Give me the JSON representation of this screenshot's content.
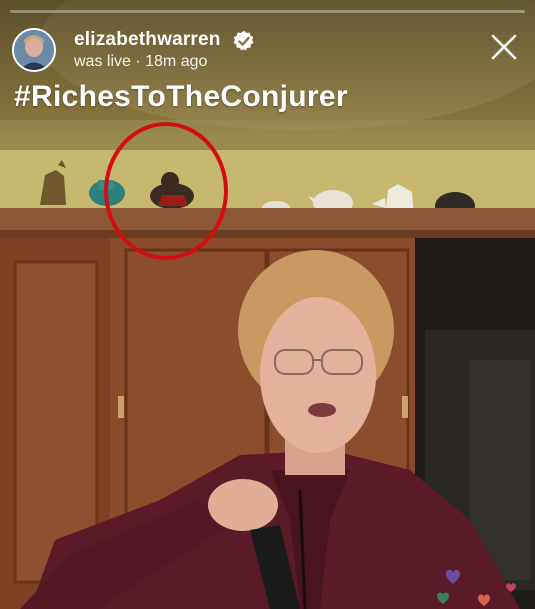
{
  "header": {
    "username": "elizabethwarren",
    "status": "was live",
    "separator": " · ",
    "time_ago": "18m ago",
    "progress": 0.0
  },
  "caption": "#RichesToTheConjurer",
  "icons": {
    "verified": "verified-badge-icon",
    "close": "close-icon",
    "avatar": "profile-avatar"
  },
  "colors": {
    "annotation_circle": "#d20f0f",
    "text": "#ffffff"
  }
}
